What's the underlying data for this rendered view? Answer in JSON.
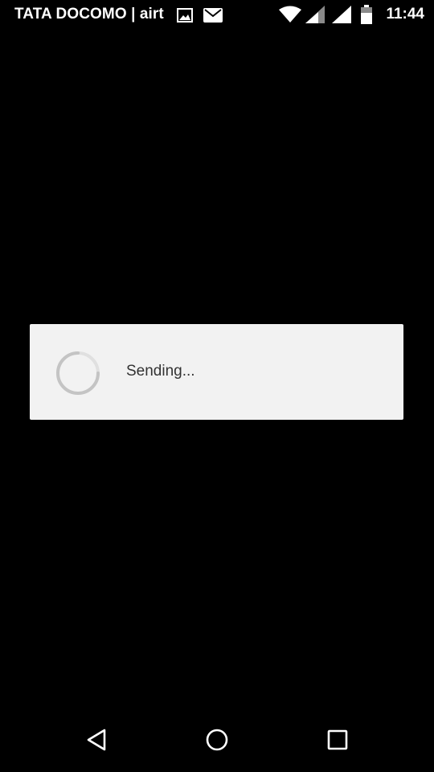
{
  "status_bar": {
    "carrier": "TATA DOCOMO | airt",
    "time": "11:44",
    "icons": [
      "gallery-icon",
      "mail-icon",
      "wifi-icon",
      "signal-icon",
      "signal-icon",
      "battery-icon"
    ]
  },
  "dialog": {
    "message": "Sending...",
    "indicator": "progress-spinner-icon"
  },
  "navigation_bar": {
    "buttons": [
      "back-icon",
      "home-icon",
      "recents-icon"
    ]
  },
  "colors": {
    "background": "#000000",
    "dialog_background": "#f2f2f2",
    "dialog_text": "#333333",
    "status_text": "#ffffff"
  }
}
